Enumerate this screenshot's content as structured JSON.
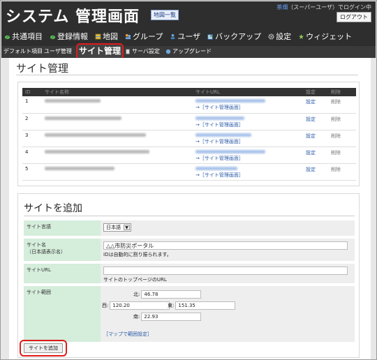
{
  "header": {
    "title": "システム 管理画面",
    "map_list_label": "地図一覧",
    "user_name": "茶畑",
    "user_status": "（スーパーユーザ）でログイン中",
    "logout_label": "ログアウト"
  },
  "nav": {
    "items": [
      {
        "label": "共通項目"
      },
      {
        "label": "登録情報"
      },
      {
        "label": "地図"
      },
      {
        "label": "グループ"
      },
      {
        "label": "ユーザ"
      },
      {
        "label": "バックアップ"
      },
      {
        "label": "設定"
      },
      {
        "label": "ウィジェット"
      }
    ]
  },
  "subnav": {
    "items": [
      {
        "label": "デフォルト項目"
      },
      {
        "label": "ユーザ管理"
      },
      {
        "label": "サイト管理"
      },
      {
        "label": "サーバ設定"
      },
      {
        "label": "アップグレード"
      }
    ]
  },
  "page": {
    "title": "サイト管理"
  },
  "sites_table": {
    "headers": [
      "ID",
      "サイト名称",
      "サイトURL",
      "設定",
      "削除"
    ],
    "manage_link_label": "→［サイト管理画面］",
    "rows": [
      {
        "id": "1",
        "setting": "設定",
        "delete": "削除"
      },
      {
        "id": "2",
        "setting": "設定",
        "delete": "削除"
      },
      {
        "id": "3",
        "setting": "設定",
        "delete": "削除"
      },
      {
        "id": "4",
        "setting": "設定",
        "delete": "削除"
      },
      {
        "id": "5",
        "setting": "設定",
        "delete": "削除"
      }
    ]
  },
  "add_site": {
    "title": "サイトを追加",
    "language_label": "サイト言語",
    "language_value": "日本語",
    "name_label": "サイト名",
    "name_sublabel": "（日本語表示名）",
    "name_value": "△△市防災ポータル",
    "name_hint": "IDは自動的に割り振られます。",
    "url_label": "サイトURL",
    "url_value": "",
    "url_hint": "サイトのトップページのURL",
    "range_label": "サイト範囲",
    "north_label": "北:",
    "north_value": "46.78",
    "west_label": "西:",
    "west_value": "120.20",
    "east_label": "東:",
    "east_value": "151.35",
    "south_label": "南:",
    "south_value": "22.93",
    "map_range_link": "［マップで範囲設定］",
    "submit_label": "サイトを追加"
  }
}
